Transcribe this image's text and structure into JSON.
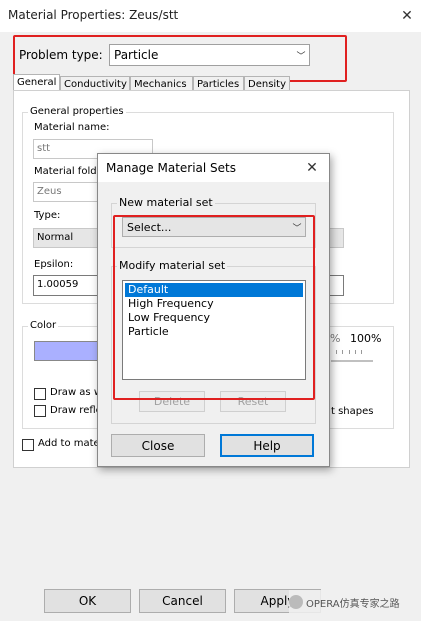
{
  "window": {
    "title": "Material Properties: Zeus/stt"
  },
  "problem_type": {
    "label": "Problem type:",
    "value": "Particle"
  },
  "tabs": [
    {
      "label": "General",
      "active": true
    },
    {
      "label": "Conductivity",
      "active": false
    },
    {
      "label": "Mechanics",
      "active": false
    },
    {
      "label": "Particles",
      "active": false
    },
    {
      "label": "Density",
      "active": false
    }
  ],
  "general": {
    "group_label": "General properties",
    "material_name_label": "Material name:",
    "material_name_value": "stt",
    "material_folder_label": "Material folde",
    "material_folder_value": "Zeus",
    "type_label": "Type:",
    "type_value": "Normal",
    "epsilon_label": "Epsilon:",
    "epsilon_value": "1.00059"
  },
  "color": {
    "group_label": "Color",
    "swatch_color": "#aab0ff",
    "percent_label": "100%",
    "percent_prefix": "%",
    "draw_as_label": "Draw as w",
    "draw_reflect_label": "Draw refle",
    "shapes_label": "t shapes"
  },
  "add_to_material": {
    "label": "Add to materi"
  },
  "footer": {
    "ok": "OK",
    "cancel": "Cancel",
    "apply": "Apply",
    "watermark": "OPERA仿真专家之路"
  },
  "dialog": {
    "title": "Manage Material Sets",
    "new_set_label": "New material set",
    "select_placeholder": "Select...",
    "modify_set_label": "Modify material set",
    "sets": [
      "Default",
      "High Frequency",
      "Low Frequency",
      "Particle"
    ],
    "selected_index": 0,
    "delete": "Delete",
    "reset": "Reset",
    "close": "Close",
    "help": "Help"
  },
  "colors": {
    "highlight_red": "#e02020",
    "selection_blue": "#0078d7"
  }
}
